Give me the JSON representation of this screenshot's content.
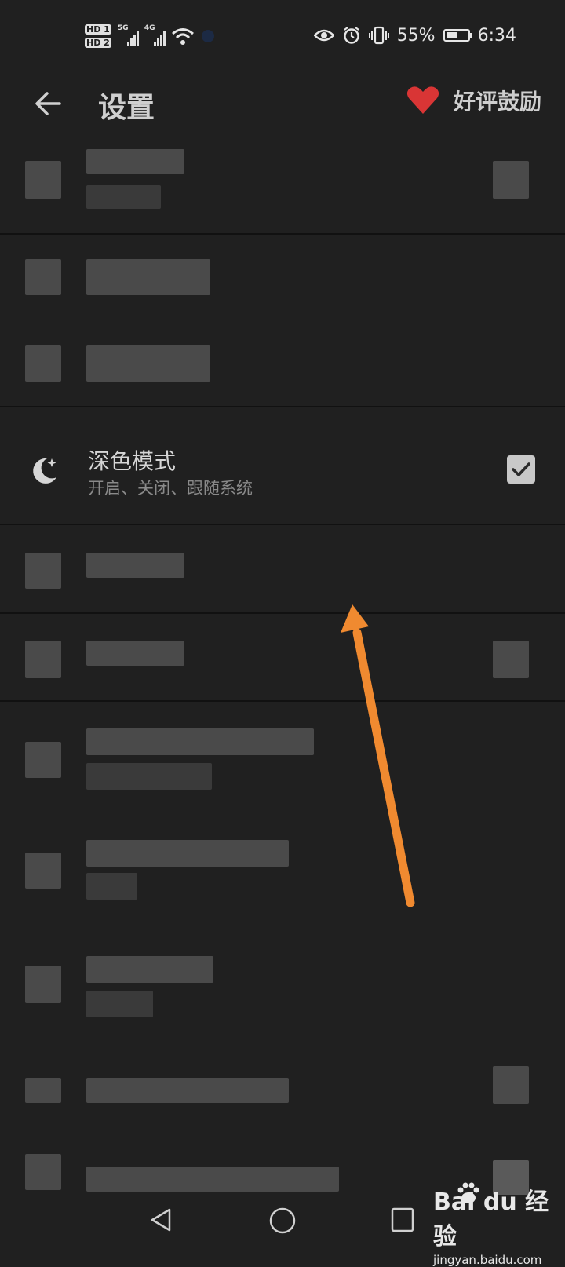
{
  "status_bar": {
    "sim1": "HD 1",
    "sim2": "HD 2",
    "net1": "5G",
    "net2": "4G",
    "battery_percent": "55%",
    "battery_level": 0.55,
    "time": "6:34"
  },
  "header": {
    "title": "设置",
    "praise_label": "好评鼓励",
    "heart_color": "#d93535"
  },
  "dark_mode_item": {
    "title": "深色模式",
    "subtitle": "开启、关闭、跟随系统",
    "checked": true
  },
  "annotation": {
    "arrow_color": "#f08a30"
  },
  "watermark": {
    "brand": "Bai du 经验",
    "url": "jingyan.baidu.com"
  },
  "icons": [
    "back-arrow-icon",
    "heart-icon",
    "moon-icon",
    "check-icon",
    "eye-icon",
    "alarm-icon",
    "vibrate-icon",
    "wifi-icon",
    "battery-icon",
    "nav-back-icon",
    "nav-home-icon",
    "nav-recents-icon"
  ]
}
